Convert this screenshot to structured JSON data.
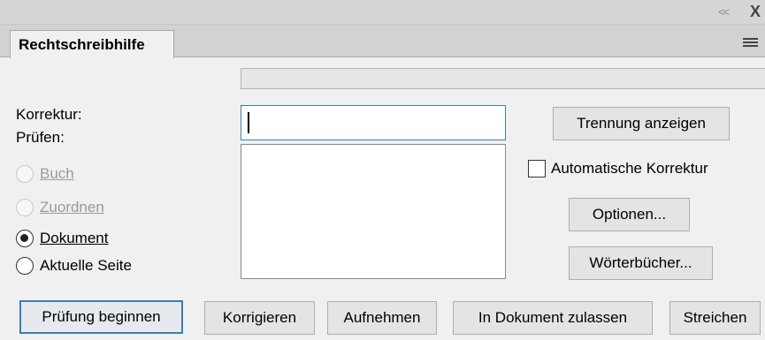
{
  "titlebar": {
    "collapse_glyph": "<<",
    "close_glyph": "X"
  },
  "tab": {
    "label": "Rechtschreibhilfe"
  },
  "form": {
    "korrektur_label": "Korrektur:",
    "korrektur_value": "",
    "pruefen_label": "Prüfen:"
  },
  "radios": [
    {
      "label": "Buch",
      "selected": false,
      "enabled": false
    },
    {
      "label": "Zuordnen",
      "selected": false,
      "enabled": false
    },
    {
      "label": "Dokument",
      "selected": true,
      "enabled": true
    },
    {
      "label": "Aktuelle Seite",
      "selected": false,
      "enabled": true
    }
  ],
  "right_panel": {
    "trennung_button": "Trennung anzeigen",
    "auto_korrektur_label": "Automatische Korrektur",
    "auto_korrektur_checked": false,
    "optionen_button": "Optionen...",
    "woerterbuecher_button": "Wörterbücher..."
  },
  "bottom_buttons": {
    "pruefung_beginnen": "Prüfung beginnen",
    "korrigieren": "Korrigieren",
    "aufnehmen": "Aufnehmen",
    "in_dokument_zulassen": "In Dokument zulassen",
    "streichen": "Streichen"
  },
  "colors": {
    "focus_accent": "#3c7fb1",
    "panel_background": "#f0f0f0"
  }
}
